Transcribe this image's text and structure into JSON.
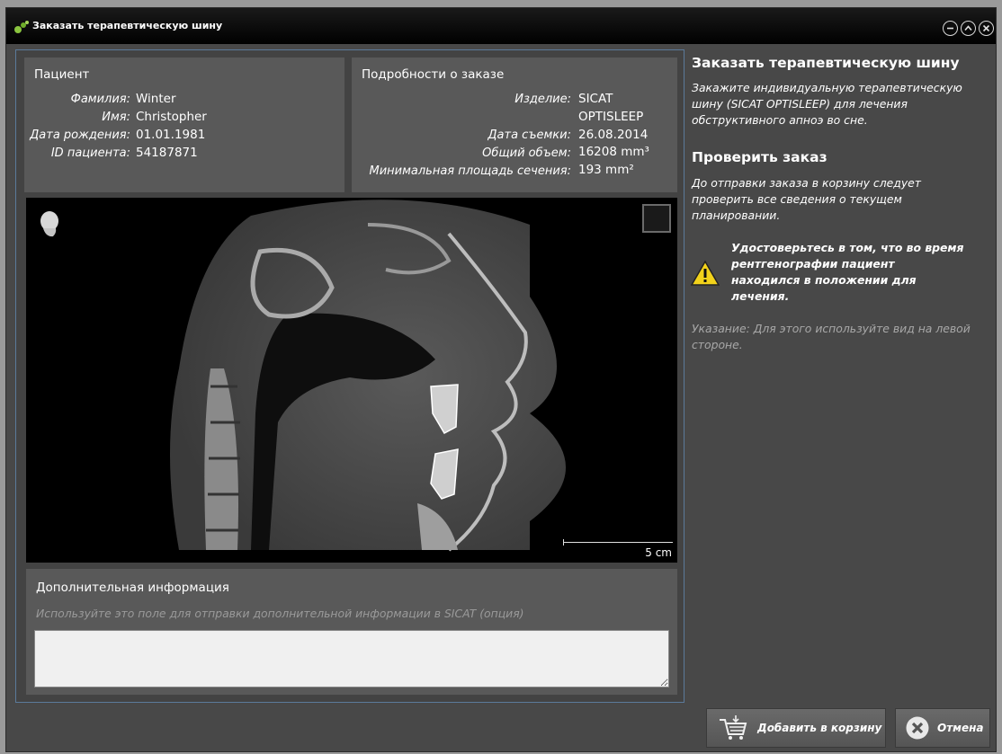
{
  "window": {
    "title": "Заказать терапевтическую шину"
  },
  "patient": {
    "heading": "Пациент",
    "rows": [
      {
        "label": "Фамилия:",
        "value": "Winter"
      },
      {
        "label": "Имя:",
        "value": "Christopher"
      },
      {
        "label": "Дата рождения:",
        "value": "01.01.1981"
      },
      {
        "label": "ID пациента:",
        "value": "54187871"
      }
    ]
  },
  "order": {
    "heading": "Подробности о заказе",
    "rows": [
      {
        "label": "Изделие:",
        "value": "SICAT",
        "value2": "OPTISLEEP"
      },
      {
        "label": "Дата съемки:",
        "value": "26.08.2014"
      },
      {
        "label": "Общий объем:",
        "value": "16208 mm³"
      },
      {
        "label": "Минимальная площадь сечения:",
        "value": "193 mm²"
      }
    ]
  },
  "viewer": {
    "scale_label": "5 cm"
  },
  "additional_info": {
    "heading": "Дополнительная информация",
    "hint": "Используйте это поле для отправки дополнительной информации в SICAT (опция)",
    "value": ""
  },
  "sidebar": {
    "title": "Заказать терапевтическую шину",
    "description_lines": [
      "Закажите индивидуальную терапевтическую",
      "шину (SICAT OPTISLEEP) для лечения",
      "обструктивного апноэ во сне."
    ],
    "check_title": "Проверить заказ",
    "check_lines": [
      "До отправки заказа в корзину следует",
      "проверить все сведения о текущем",
      "планировании."
    ],
    "warning_lines": [
      "Удостоверьтесь в том, что во время",
      "рентгенографии пациент",
      "находился в положении для",
      "лечения."
    ],
    "hint_lines": [
      "Указание: Для этого используйте вид на левой",
      "стороне."
    ]
  },
  "buttons": {
    "add_to_cart": "Добавить в корзину",
    "cancel": "Отмена"
  },
  "colors": {
    "window_bg": "#484848",
    "panel_bg": "#595959",
    "frame_border": "#5b7a9a",
    "warning_yellow": "#f2d21b"
  }
}
